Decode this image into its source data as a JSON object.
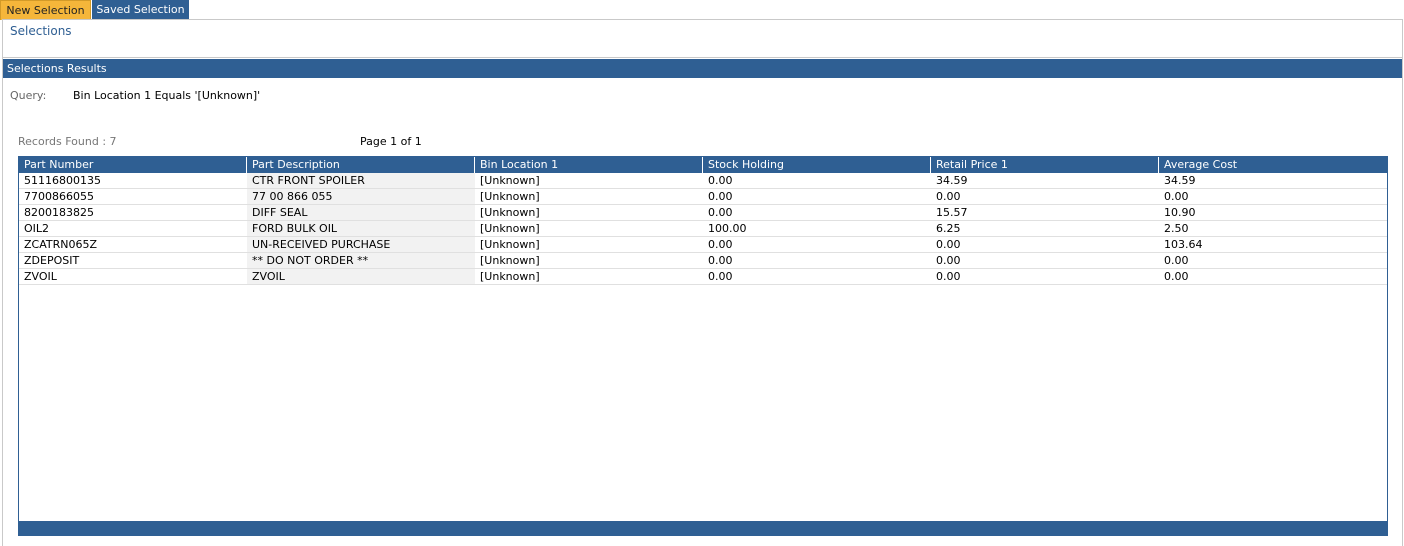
{
  "tabs": {
    "new_selection": "New Selection",
    "saved_selection": "Saved Selection"
  },
  "selections": {
    "title": "Selections"
  },
  "results": {
    "header": "Selections Results",
    "query_label": "Query:",
    "query_value": "Bin Location 1 Equals '[Unknown]'",
    "records_found": "Records Found : 7",
    "page_info": "Page 1 of 1"
  },
  "table": {
    "columns": [
      "Part Number",
      "Part Description",
      "Bin Location 1",
      "Stock Holding",
      "Retail Price 1",
      "Average Cost"
    ],
    "rows": [
      [
        "51116800135",
        "CTR FRONT SPOILER",
        "[Unknown]",
        "0.00",
        "34.59",
        "34.59"
      ],
      [
        "7700866055",
        "77 00 866 055",
        "[Unknown]",
        "0.00",
        "0.00",
        "0.00"
      ],
      [
        "8200183825",
        "DIFF SEAL",
        "[Unknown]",
        "0.00",
        "15.57",
        "10.90"
      ],
      [
        "OIL2",
        "FORD BULK OIL",
        "[Unknown]",
        "100.00",
        "6.25",
        "2.50"
      ],
      [
        "ZCATRN065Z",
        "UN-RECEIVED PURCHASE",
        "[Unknown]",
        "0.00",
        "0.00",
        "103.64"
      ],
      [
        "ZDEPOSIT",
        "** DO NOT ORDER **",
        "[Unknown]",
        "0.00",
        "0.00",
        "0.00"
      ],
      [
        "ZVOIL",
        "ZVOIL",
        "[Unknown]",
        "0.00",
        "0.00",
        "0.00"
      ]
    ]
  },
  "colors": {
    "accent_blue": "#2f5f93",
    "active_tab": "#f5b63a"
  }
}
